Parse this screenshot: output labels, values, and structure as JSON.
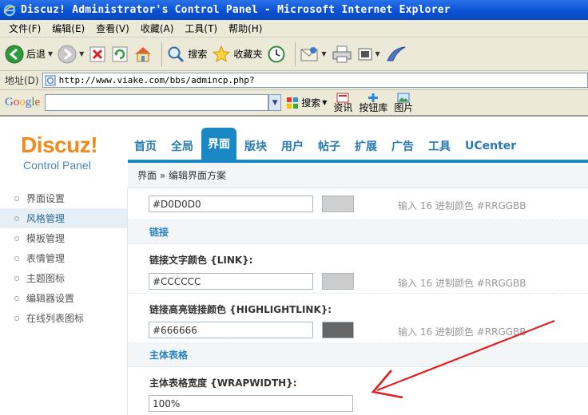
{
  "window": {
    "title": "Discuz! Administrator's Control Panel - Microsoft Internet Explorer"
  },
  "menubar": {
    "items": [
      "文件(F)",
      "编辑(E)",
      "查看(V)",
      "收藏(A)",
      "工具(T)",
      "帮助(H)"
    ]
  },
  "toolbar": {
    "back_label": "后退",
    "search_label": "搜索",
    "favorites_label": "收藏夹"
  },
  "addressbar": {
    "label": "地址(D)",
    "url": "http://www.viake.com/bbs/admincp.php?"
  },
  "googlebar": {
    "logo": "Google",
    "search_label": "搜索",
    "news_label": "资讯",
    "buttons_label": "按钮库",
    "images_label": "图片"
  },
  "brand": {
    "logo": "Discuz!",
    "subtitle": "Control Panel"
  },
  "nav": {
    "items": [
      "首页",
      "全局",
      "界面",
      "版块",
      "用户",
      "帖子",
      "扩展",
      "广告",
      "工具",
      "UCenter"
    ],
    "active_index": 2
  },
  "breadcrumb": "界面 » 编辑界面方案",
  "sidebar": {
    "items": [
      "界面设置",
      "风格管理",
      "模板管理",
      "表情管理",
      "主题图标",
      "编辑器设置",
      "在线列表图标"
    ],
    "active_index": 1
  },
  "main": {
    "hint": "输入 16 进制颜色 #RRGGBB",
    "top_field": {
      "value": "#D0D0D0",
      "swatch": "#D0D0D0"
    },
    "section_link": "链接",
    "link_color": {
      "label": "链接文字颜色 {LINK}:",
      "value": "#CCCCCC",
      "swatch": "#CCCCCC"
    },
    "highlight_link": {
      "label": "链接高亮链接颜色 {HIGHLIGHTLINK}:",
      "value": "#666666",
      "swatch": "#666666"
    },
    "section_table": "主体表格",
    "wrap_width": {
      "label": "主体表格宽度 {WRAPWIDTH}:",
      "value": "100%"
    }
  },
  "colors": {
    "accent": "#1a88c4",
    "logo_orange": "#f08a1a",
    "annotation_arrow": "#e02020"
  }
}
